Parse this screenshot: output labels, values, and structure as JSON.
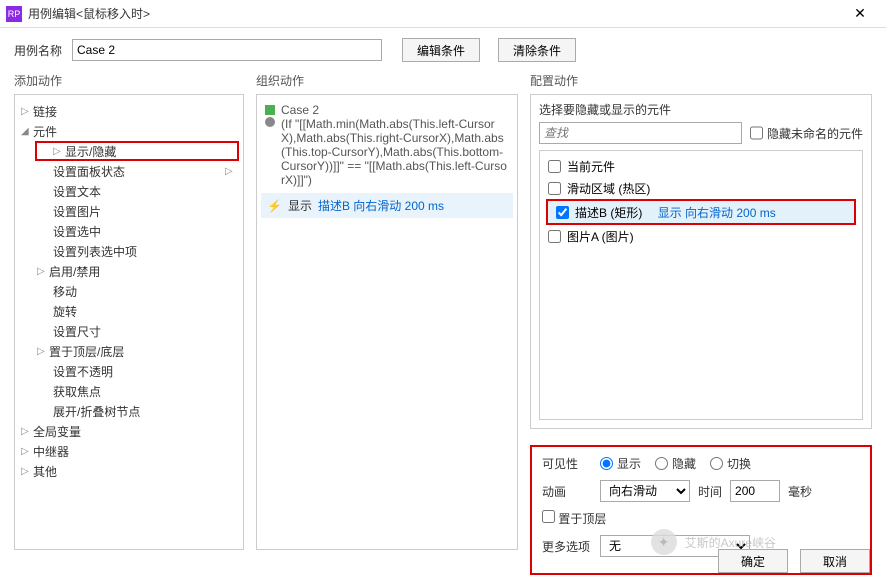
{
  "window": {
    "title": "用例编辑<鼠标移入时>",
    "close": "✕",
    "appicon": "RP"
  },
  "namebar": {
    "label": "用例名称",
    "value": "Case 2",
    "edit_cond": "编辑条件",
    "clear_cond": "清除条件"
  },
  "columns": {
    "add_action": "添加动作",
    "org_action": "组织动作",
    "cfg_action": "配置动作"
  },
  "tree": {
    "link": "链接",
    "widget": "元件",
    "items": [
      "显示/隐藏",
      "设置面板状态",
      "设置文本",
      "设置图片",
      "设置选中",
      "设置列表选中项",
      "启用/禁用",
      "移动",
      "旋转",
      "设置尺寸",
      "置于顶层/底层",
      "设置不透明",
      "获取焦点",
      "展开/折叠树节点"
    ],
    "globalvar": "全局变量",
    "repeater": "中继器",
    "other": "其他"
  },
  "case": {
    "name": "Case 2",
    "cond": "(If \"[[Math.min(Math.abs(This.left-CursorX),Math.abs(This.right-CursorX),Math.abs(This.top-CursorY),Math.abs(This.bottom-CursorY))]]\" == \"[[Math.abs(This.left-CursorX)]]\")",
    "action_prefix": "显示",
    "action_link": "描述B 向右滑动 200 ms"
  },
  "config": {
    "select_title": "选择要隐藏或显示的元件",
    "search_ph": "查找",
    "hide_unnamed": "隐藏未命名的元件",
    "widgets": {
      "current": "当前元件",
      "scroll": "滑动区域 (热区)",
      "descB_name": "描述B (矩形)",
      "descB_act": "显示 向右滑动 200 ms",
      "picA": "图片A (图片)"
    },
    "visibility": {
      "label": "可见性",
      "show": "显示",
      "hide": "隐藏",
      "toggle": "切换"
    },
    "anim": {
      "label": "动画",
      "value": "向右滑动",
      "time_label": "时间",
      "time_value": "200",
      "unit": "毫秒"
    },
    "bring_top": "置于顶层",
    "more": {
      "label": "更多选项",
      "value": "无"
    }
  },
  "footer": {
    "ok": "确定",
    "cancel": "取消"
  },
  "watermark": "艾斯的Axure峡谷"
}
